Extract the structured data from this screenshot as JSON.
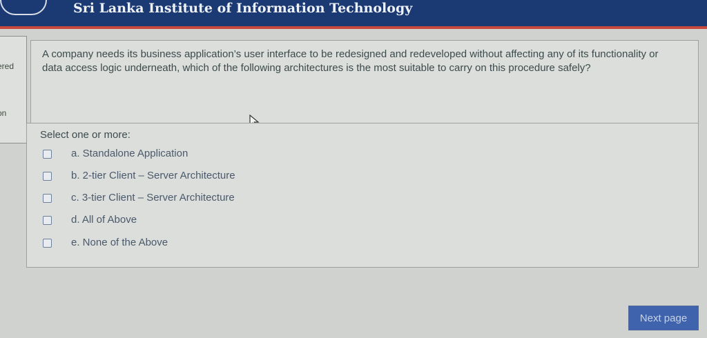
{
  "header": {
    "site_title": "Sri Lanka Institute of Information Technology",
    "accent_color": "#1b3a73",
    "stripe_color": "#c9483d"
  },
  "sidebar": {
    "text_1": "ered",
    "text_2": "",
    "text_3": "on"
  },
  "question": {
    "text": "A company needs its business application’s user interface to be redesigned and redeveloped without affecting any of its functionality or data access logic underneath, which of the following architectures is the most suitable to carry on this procedure safely?",
    "prompt": "Select one or more:",
    "options": [
      {
        "label": "a. Standalone Application",
        "checked": false
      },
      {
        "label": "b. 2-tier Client – Server Architecture",
        "checked": false
      },
      {
        "label": "c. 3-tier Client – Server Architecture",
        "checked": false
      },
      {
        "label": "d. All of Above",
        "checked": false
      },
      {
        "label": "e. None of the Above",
        "checked": false
      }
    ]
  },
  "navigation": {
    "next_label": "Next page",
    "button_color": "#3f64ad"
  },
  "icons": {
    "cursor": "mouse-pointer-icon",
    "logo": "logo-icon"
  }
}
